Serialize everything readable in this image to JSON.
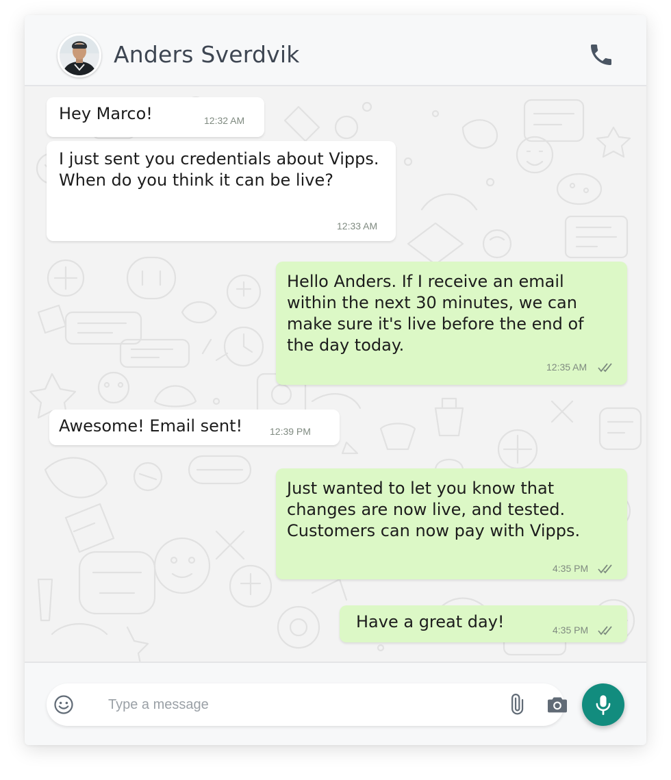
{
  "contact": {
    "name": "Anders Sverdvik",
    "avatar": "profile-photo"
  },
  "header_icons": {
    "call": "phone-icon"
  },
  "messages": [
    {
      "direction": "incoming",
      "text": "Hey Marco!",
      "time": "12:32 AM"
    },
    {
      "direction": "incoming",
      "text": "I just sent you credentials about Vipps. When do you think it can be live?",
      "time": "12:33 AM"
    },
    {
      "direction": "outgoing",
      "text": "Hello Anders. If I receive an email within the next 30 minutes, we can make sure it's live before the end of the day today.",
      "time": "12:35 AM",
      "status": "double-check-icon"
    },
    {
      "direction": "incoming",
      "text": "Awesome! Email sent!",
      "time": "12:39 PM"
    },
    {
      "direction": "outgoing",
      "text": "Just wanted to let you know that changes are now live, and tested. Customers can now pay with Vipps.",
      "time": "4:35 PM",
      "status": "double-check-icon"
    },
    {
      "direction": "outgoing",
      "text": "Have a great day!",
      "time": "4:35 PM",
      "status": "double-check-icon"
    }
  ],
  "composer": {
    "placeholder": "Type a message",
    "value": "",
    "icons": [
      "emoji-icon",
      "paperclip-icon",
      "camera-icon",
      "microphone-icon"
    ]
  },
  "colors": {
    "incoming_bubble": "#ffffff",
    "outgoing_bubble": "#dcf8c6",
    "accent": "#128c7e",
    "chat_background": "#f3f3f3"
  }
}
